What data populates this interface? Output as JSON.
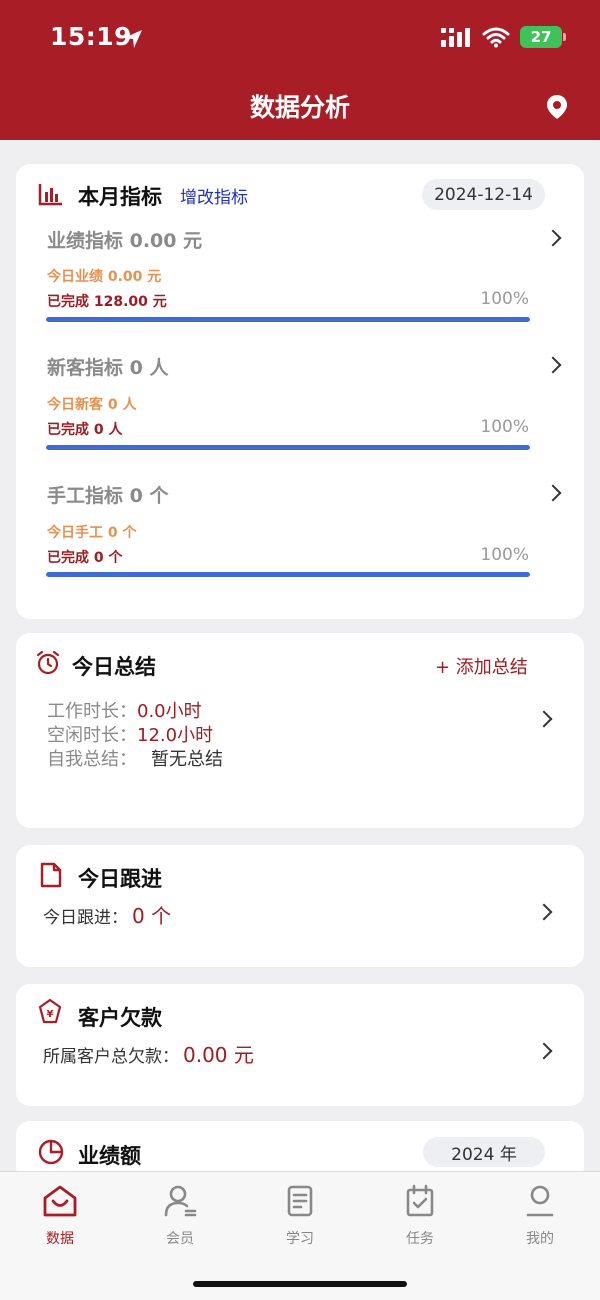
{
  "status_bar": {
    "time": "15:19",
    "battery": "27"
  },
  "nav": {
    "title": "数据分析",
    "location_icon": "location-pin-icon"
  },
  "colors": {
    "brand": "#a91e26",
    "accent_red": "#a01c22",
    "link_blue": "#2230c4",
    "progress_blue": "#3f6bd6",
    "today_orange": "#e8914f"
  },
  "monthly": {
    "title": "本月指标",
    "edit_link": "增改指标",
    "date": "2024-12-14",
    "metrics": [
      {
        "title": "业绩指标 0.00 元",
        "today": "今日业绩 0.00 元",
        "done": "已完成 128.00 元",
        "percent": "100%",
        "progress": 1.0
      },
      {
        "title": "新客指标 0 人",
        "today": "今日新客 0 人",
        "done": "已完成 0 人",
        "percent": "100%",
        "progress": 1.0
      },
      {
        "title": "手工指标 0 个",
        "today": "今日手工 0 个",
        "done": "已完成 0 个",
        "percent": "100%",
        "progress": 1.0
      }
    ]
  },
  "summary": {
    "title": "今日总结",
    "add_label": "+ 添加总结",
    "work_label": "工作时长：",
    "work_value": "0.0小时",
    "idle_label": "空闲时长：",
    "idle_value": "12.0小时",
    "self_label": "自我总结：",
    "self_value": "暂无总结"
  },
  "followup": {
    "title": "今日跟进",
    "label": "今日跟进：",
    "value": "0 个"
  },
  "debt": {
    "title": "客户欠款",
    "label": "所属客户总欠款：",
    "value": "0.00 元"
  },
  "performance": {
    "title": "业绩额",
    "year": "2024 年"
  },
  "tabs": [
    {
      "label": "数据",
      "icon": "home-icon",
      "active": true
    },
    {
      "label": "会员",
      "icon": "member-icon",
      "active": false
    },
    {
      "label": "学习",
      "icon": "study-icon",
      "active": false
    },
    {
      "label": "任务",
      "icon": "task-icon",
      "active": false
    },
    {
      "label": "我的",
      "icon": "profile-icon",
      "active": false
    }
  ]
}
